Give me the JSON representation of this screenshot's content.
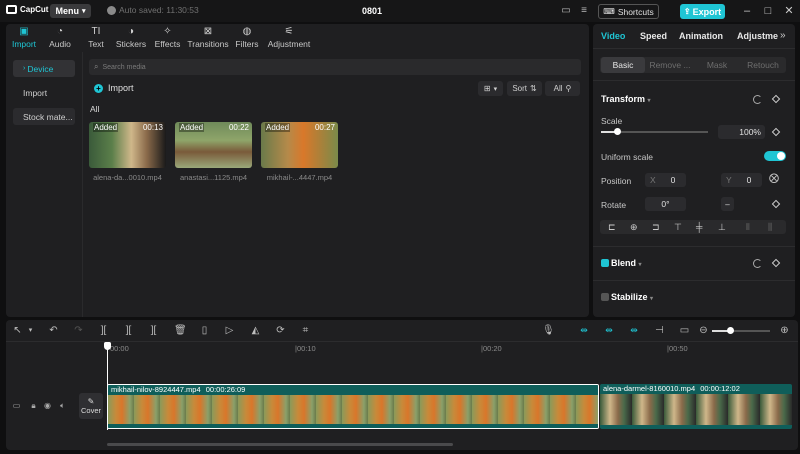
{
  "titlebar": {
    "app_name": "CapCut",
    "menu_label": "Menu",
    "autosave_text": "Auto saved: 11:30:53",
    "project_title": "0801",
    "shortcuts_label": "Shortcuts",
    "export_label": "Export"
  },
  "media_panel": {
    "tabs": [
      {
        "label": "Import",
        "icon": "import-icon"
      },
      {
        "label": "Audio",
        "icon": "audio-icon"
      },
      {
        "label": "Text",
        "icon": "text-icon"
      },
      {
        "label": "Stickers",
        "icon": "stickers-icon"
      },
      {
        "label": "Effects",
        "icon": "effects-icon"
      },
      {
        "label": "Transitions",
        "icon": "transitions-icon"
      },
      {
        "label": "Filters",
        "icon": "filters-icon"
      },
      {
        "label": "Adjustment",
        "icon": "adjustment-icon"
      }
    ],
    "sidebar": [
      "Device",
      "Import",
      "Stock mate..."
    ],
    "search_placeholder": "Search media",
    "import_label": "Import",
    "sort_label": "Sort",
    "all_filter": "All",
    "all_heading": "All",
    "items": [
      {
        "badge": "Added",
        "duration": "00:13",
        "name": "alena-da...0010.mp4"
      },
      {
        "badge": "Added",
        "duration": "00:22",
        "name": "anastasi...1125.mp4"
      },
      {
        "badge": "Added",
        "duration": "00:27",
        "name": "mikhail-...4447.mp4"
      }
    ]
  },
  "inspector": {
    "tabs": [
      "Video",
      "Speed",
      "Animation",
      "Adjustme"
    ],
    "segments": [
      "Basic",
      "Remove ...",
      "Mask",
      "Retouch"
    ],
    "transform_title": "Transform",
    "scale_label": "Scale",
    "scale_value": "100%",
    "scale_fraction": 0.15,
    "uniform_scale_label": "Uniform scale",
    "uniform_scale_on": true,
    "position_label": "Position",
    "position_x_label": "X",
    "position_x": "0",
    "position_y_label": "Y",
    "position_y": "0",
    "rotate_label": "Rotate",
    "rotate_value": "0°",
    "blend_title": "Blend",
    "stabilize_title": "Stabilize"
  },
  "timeline": {
    "ruler": [
      "00:00",
      "|00:10",
      "|00:20",
      "|00:50"
    ],
    "cover_label": "Cover",
    "clips": [
      {
        "name": "mikhail-nilov-8924447.mp4",
        "duration": "00:00:26:09"
      },
      {
        "name": "alena-darmel-8160010.mp4",
        "duration": "00:00:12:02"
      }
    ]
  },
  "colors": {
    "accent": "#1fc5d4",
    "panel": "#1f1f21",
    "background": "#0f0f10",
    "clip_teal": "#0f5e5a"
  }
}
